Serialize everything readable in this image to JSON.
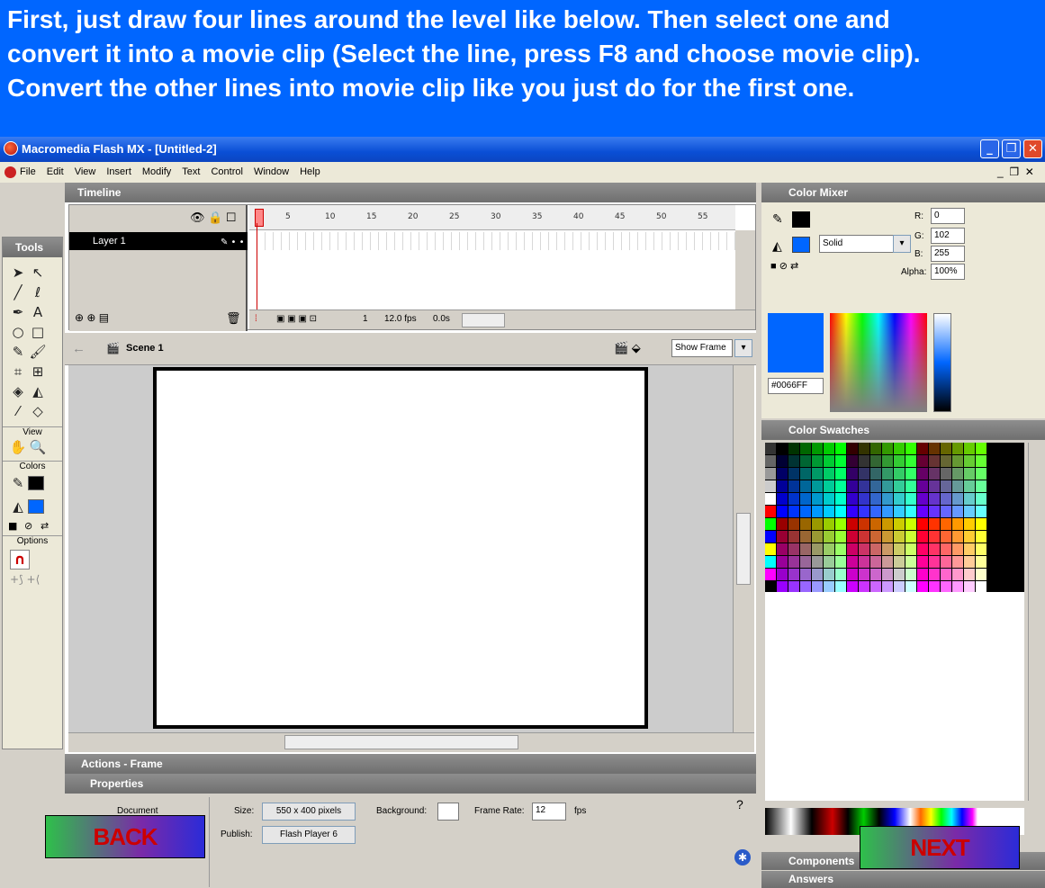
{
  "banner": {
    "text": "First, just draw four lines around the level like below. Then select one and\nconvert it into a movie clip (Select the line, press F8 and choose movie clip).\nConvert the other lines into movie clip like you just do for the first one."
  },
  "window": {
    "title": "Macromedia Flash MX - [Untitled-2]"
  },
  "menu": [
    "File",
    "Edit",
    "View",
    "Insert",
    "Modify",
    "Text",
    "Control",
    "Window",
    "Help"
  ],
  "timeline": {
    "title": "Timeline",
    "layer": "Layer 1",
    "frame_labels": [
      "1",
      "5",
      "10",
      "15",
      "20",
      "25",
      "30",
      "35",
      "40",
      "45",
      "50",
      "55"
    ],
    "frame": "1",
    "fps": "12.0 fps",
    "time": "0.0s"
  },
  "tools": {
    "title": "Tools",
    "view": "View",
    "colors": "Colors",
    "options": "Options"
  },
  "scene": {
    "name": "Scene 1",
    "show_frame": "Show Frame"
  },
  "color_mixer": {
    "title": "Color Mixer",
    "fill_type": "Solid",
    "r_label": "R:",
    "r": "0",
    "g_label": "G:",
    "g": "102",
    "b_label": "B:",
    "b": "255",
    "alpha_label": "Alpha:",
    "alpha": "100%",
    "hex": "#0066FF"
  },
  "color_swatches": {
    "title": "Color Swatches"
  },
  "panels": {
    "actions": "Actions - Frame",
    "properties": "Properties",
    "components": "Components",
    "answers": "Answers"
  },
  "properties": {
    "type": "Document",
    "size_label": "Size:",
    "size": "550 x 400 pixels",
    "background_label": "Background:",
    "frame_rate_label": "Frame Rate:",
    "frame_rate": "12",
    "fps_unit": "fps",
    "publish_label": "Publish:",
    "publish": "Flash Player 6"
  },
  "nav": {
    "back": "BACK",
    "next": "NEXT"
  },
  "colors": {
    "accent": "#0066ff",
    "panel": "#d4d0c8",
    "header": "#7a7a7a"
  }
}
